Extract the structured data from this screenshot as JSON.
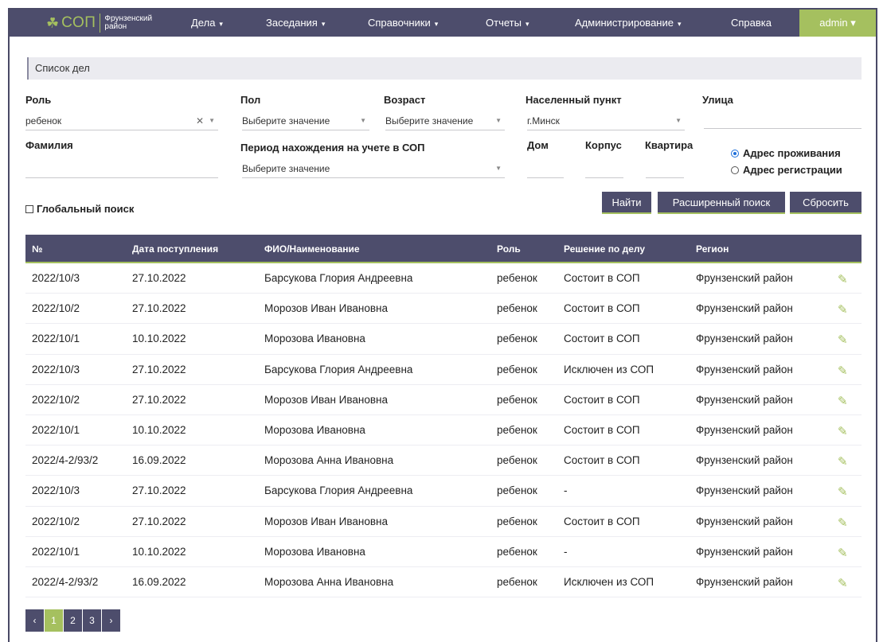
{
  "brand": {
    "logo_text": "СОП",
    "district": "Фрунзенский район"
  },
  "nav": {
    "items": [
      {
        "label": "Дела",
        "caret": "▾"
      },
      {
        "label": "Заседания",
        "caret": "▾"
      },
      {
        "label": "Справочники",
        "caret": "▾"
      },
      {
        "label": "Отчеты",
        "caret": "▾"
      },
      {
        "label": "Администрирование",
        "caret": "▾"
      },
      {
        "label": "Справка",
        "caret": ""
      }
    ],
    "user": "admin ▾"
  },
  "breadcrumb": "Список дел",
  "filters": {
    "role": {
      "label": "Роль",
      "value": "ребенок"
    },
    "gender": {
      "label": "Пол",
      "placeholder": "Выберите значение"
    },
    "age": {
      "label": "Возраст",
      "placeholder": "Выберите значение"
    },
    "locality": {
      "label": "Населенный пункт",
      "value": "г.Минск"
    },
    "street": {
      "label": "Улица"
    },
    "surname": {
      "label": "Фамилия"
    },
    "period": {
      "label": "Период нахождения на учете в СОП",
      "placeholder": "Выберите значение"
    },
    "house": {
      "label": "Дом"
    },
    "building": {
      "label": "Корпус"
    },
    "apartment": {
      "label": "Квартира"
    },
    "address_residence": "Адрес проживания",
    "address_registration": "Адрес регистрации",
    "global_search": "Глобальный поиск"
  },
  "buttons": {
    "find": "Найти",
    "advanced": "Расширенный поиск",
    "reset": "Сбросить"
  },
  "table": {
    "headers": [
      "№",
      "Дата поступления",
      "ФИО/Наименование",
      "Роль",
      "Решение по делу",
      "Регион"
    ],
    "rows": [
      [
        "2022/10/3",
        "27.10.2022",
        "Барсукова Глория Андреевна",
        "ребенок",
        "Состоит в СОП",
        "Фрунзенский район"
      ],
      [
        "2022/10/2",
        "27.10.2022",
        "Морозов Иван Ивановна",
        "ребенок",
        "Состоит в СОП",
        "Фрунзенский район"
      ],
      [
        "2022/10/1",
        "10.10.2022",
        "Морозова Ивановна",
        "ребенок",
        "Состоит в СОП",
        "Фрунзенский район"
      ],
      [
        "2022/10/3",
        "27.10.2022",
        "Барсукова Глория Андреевна",
        "ребенок",
        "Исключен из СОП",
        "Фрунзенский район"
      ],
      [
        "2022/10/2",
        "27.10.2022",
        "Морозов Иван Ивановна",
        "ребенок",
        "Состоит в СОП",
        "Фрунзенский район"
      ],
      [
        "2022/10/1",
        "10.10.2022",
        "Морозова Ивановна",
        "ребенок",
        "Состоит в СОП",
        "Фрунзенский район"
      ],
      [
        "2022/4-2/93/2",
        "16.09.2022",
        "Морозова Анна Ивановна",
        "ребенок",
        "Состоит в СОП",
        "Фрунзенский район"
      ],
      [
        "2022/10/3",
        "27.10.2022",
        "Барсукова Глория Андреевна",
        "ребенок",
        "-",
        "Фрунзенский район"
      ],
      [
        "2022/10/2",
        "27.10.2022",
        "Морозов Иван Ивановна",
        "ребенок",
        "Состоит в СОП",
        "Фрунзенский район"
      ],
      [
        "2022/10/1",
        "10.10.2022",
        "Морозова Ивановна",
        "ребенок",
        "-",
        "Фрунзенский район"
      ],
      [
        "2022/4-2/93/2",
        "16.09.2022",
        "Морозова Анна Ивановна",
        "ребенок",
        "Исключен из СОП",
        "Фрунзенский район"
      ]
    ]
  },
  "pagination": {
    "prev": "‹",
    "pages": [
      "1",
      "2",
      "3"
    ],
    "next": "›",
    "active": "1"
  },
  "colors": {
    "nav_bg": "#4d4d6c",
    "accent": "#a5c05f"
  }
}
